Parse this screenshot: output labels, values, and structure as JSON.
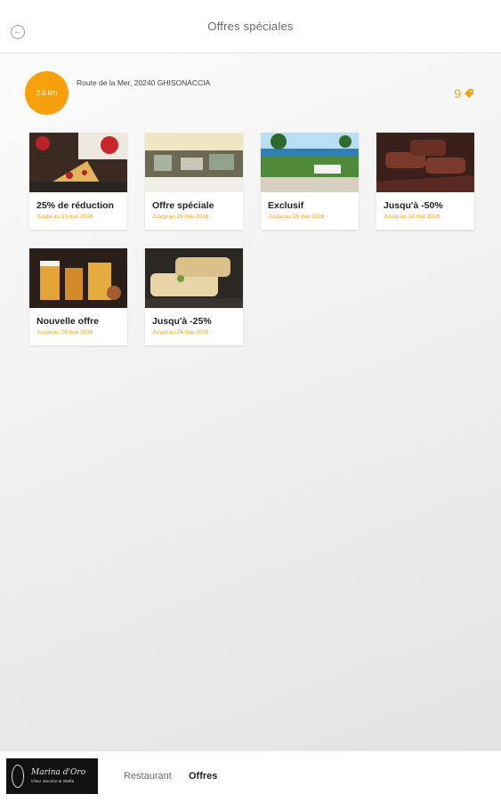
{
  "header": {
    "title": "Offres spéciales"
  },
  "info": {
    "distance": "2.5 km",
    "address": "Route de la Mer, 20240 GHISONACCIA",
    "offers_count": "9"
  },
  "offers": [
    {
      "label": "25% de réduction",
      "date": "Jusqu'au 13 mai 2016"
    },
    {
      "label": "Offre spéciale",
      "date": "Jusqu'au 29 mai 2016"
    },
    {
      "label": "Exclusif",
      "date": "Jusqu'au 26 mai 2016"
    },
    {
      "label": "Jusqu'à -50%",
      "date": "Jusqu'au 18 mai 2016"
    },
    {
      "label": "Nouvelle offre",
      "date": "Jusqu'au 28 mai 2016"
    },
    {
      "label": "Jusqu'à -25%",
      "date": "Jusqu'au 24 mai 2016"
    }
  ],
  "footer": {
    "logo_text": "Marina d'Oro",
    "logo_tagline": "Chez Jacomo & Stella",
    "nav_restaurant": "Restaurant",
    "nav_offres": "Offres"
  },
  "colors": {
    "accent": "#f7a00d",
    "date_color": "#f3a11b"
  },
  "icons": {
    "back": "back-arrow-circle-icon",
    "tag": "price-tag-icon"
  }
}
